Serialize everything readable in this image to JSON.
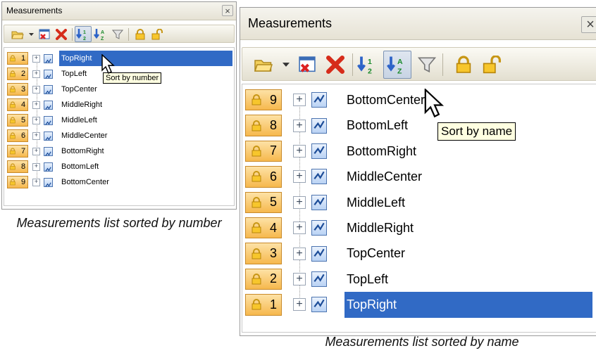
{
  "left_panel": {
    "title": "Measurements",
    "close_glyph": "×",
    "toolbar_icons": [
      "open-folder-icon",
      "dropdown-arrow-icon",
      "window-delete-icon",
      "delete-x-icon",
      "sort-by-number-icon",
      "sort-by-name-icon",
      "filter-funnel-icon",
      "lock-icon",
      "unlock-icon"
    ],
    "tooltip": "Sort by number",
    "rows": [
      {
        "num": "1",
        "label": "TopRight",
        "selected": true
      },
      {
        "num": "2",
        "label": "TopLeft",
        "selected": false
      },
      {
        "num": "3",
        "label": "TopCenter",
        "selected": false
      },
      {
        "num": "4",
        "label": "MiddleRight",
        "selected": false
      },
      {
        "num": "5",
        "label": "MiddleLeft",
        "selected": false
      },
      {
        "num": "6",
        "label": "MiddleCenter",
        "selected": false
      },
      {
        "num": "7",
        "label": "BottomRight",
        "selected": false
      },
      {
        "num": "8",
        "label": "BottomLeft",
        "selected": false
      },
      {
        "num": "9",
        "label": "BottomCenter",
        "selected": false
      }
    ],
    "caption": "Measurements list sorted by number"
  },
  "right_panel": {
    "title": "Measurements",
    "close_glyph": "×",
    "tooltip": "Sort by name",
    "rows": [
      {
        "num": "9",
        "label": "BottomCenter",
        "selected": false
      },
      {
        "num": "8",
        "label": "BottomLeft",
        "selected": false
      },
      {
        "num": "7",
        "label": "BottomRight",
        "selected": false
      },
      {
        "num": "6",
        "label": "MiddleCenter",
        "selected": false
      },
      {
        "num": "5",
        "label": "MiddleLeft",
        "selected": false
      },
      {
        "num": "4",
        "label": "MiddleRight",
        "selected": false
      },
      {
        "num": "3",
        "label": "TopCenter",
        "selected": false
      },
      {
        "num": "2",
        "label": "TopLeft",
        "selected": false
      },
      {
        "num": "1",
        "label": "TopRight",
        "selected": true
      }
    ],
    "caption": "Measurements list sorted by name"
  },
  "colors": {
    "selection": "#316ac5",
    "badge": "#f6b84d",
    "tooltip_bg": "#ffffe1"
  }
}
